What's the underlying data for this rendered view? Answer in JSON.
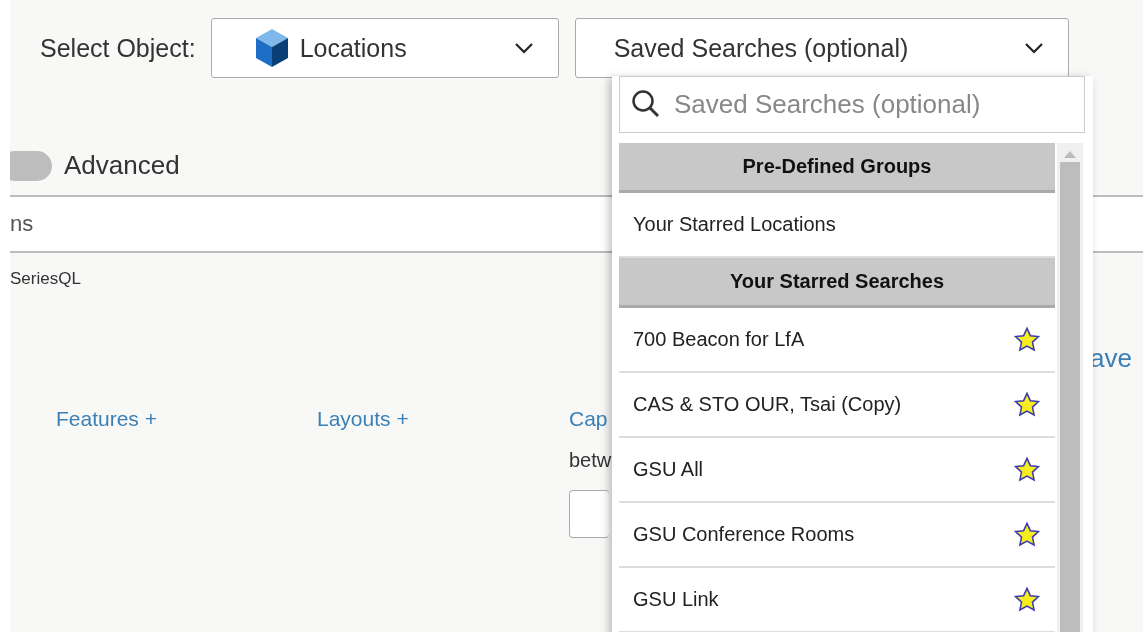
{
  "object_select": {
    "label": "Select Object:",
    "value": "Locations"
  },
  "saved_search_select": {
    "placeholder": "Saved Searches (optional)",
    "expanded": true
  },
  "advanced_toggle": {
    "label": "Advanced",
    "on": false
  },
  "tab_strip": {
    "label": "ns"
  },
  "query_type": "SeriesQL",
  "links": [
    "Features +",
    "Layouts +",
    "Cap"
  ],
  "between_label": "betw",
  "side_link": "ave",
  "dropdown": {
    "search_placeholder": "Saved Searches (optional)",
    "items": [
      {
        "kind": "header",
        "label": "Pre-Defined Groups"
      },
      {
        "kind": "option",
        "label": "Your Starred Locations",
        "starred": false
      },
      {
        "kind": "header",
        "label": "Your Starred Searches"
      },
      {
        "kind": "option",
        "label": "700 Beacon for LfA",
        "starred": true
      },
      {
        "kind": "option",
        "label": "CAS & STO OUR, Tsai (Copy)",
        "starred": true
      },
      {
        "kind": "option",
        "label": "GSU All",
        "starred": true
      },
      {
        "kind": "option",
        "label": "GSU Conference Rooms",
        "starred": true
      },
      {
        "kind": "option",
        "label": "GSU Link",
        "starred": true
      }
    ]
  }
}
